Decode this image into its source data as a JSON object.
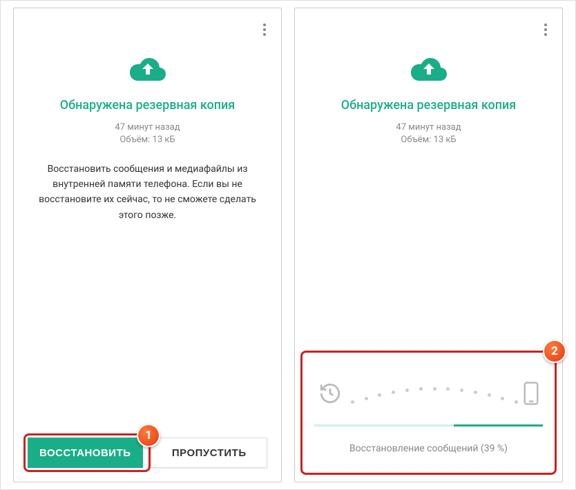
{
  "left": {
    "title": "Обнаружена резервная копия",
    "timeAgo": "47 минут назад",
    "size": "Объём: 13 кБ",
    "description": "Восстановить сообщения и медиафайлы из внутренней памяти телефона. Если вы не восстановите их сейчас, то не сможете сделать этого позже.",
    "restoreButton": "ВОССТАНОВИТЬ",
    "skipButton": "ПРОПУСТИТЬ"
  },
  "right": {
    "title": "Обнаружена резервная копия",
    "timeAgo": "47 минут назад",
    "size": "Объём: 13 кБ",
    "progressText": "Восстановление сообщений (39 %)",
    "progressPercent": 39
  },
  "markers": {
    "one": "1",
    "two": "2"
  }
}
